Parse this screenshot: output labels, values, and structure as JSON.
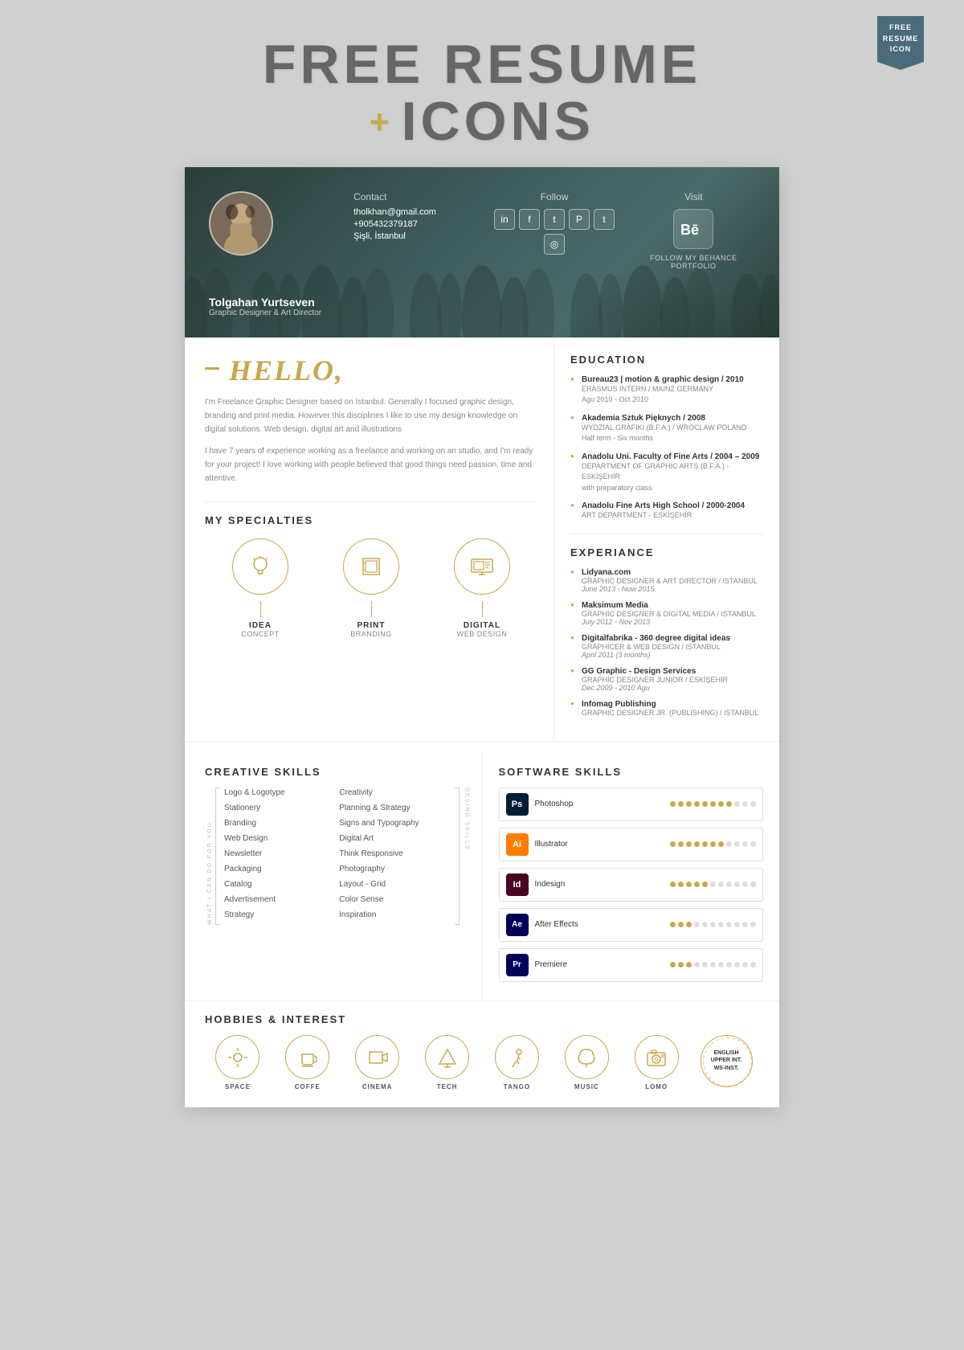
{
  "page": {
    "title_line1": "FREE RESUME",
    "title_plus": "+",
    "title_line2": "ICONS",
    "badge_line1": "FREE",
    "badge_line2": "RESUME",
    "badge_line3": "ICON"
  },
  "person": {
    "name": "Tolgahan Yurtseven",
    "title": "Graphic Designer & Art Director",
    "email": "tholkhan@gmail.com",
    "phone": "+905432379187",
    "location": "Şişli, İstanbul"
  },
  "contact": {
    "label": "Contact"
  },
  "follow": {
    "label": "Follow"
  },
  "visit": {
    "label": "Visit",
    "behance_text": "FOLLOW MY BEHANCE PORTFOLIO"
  },
  "hello": {
    "title": "HELLO,",
    "bio1": "I'm Freelance Graphic Designer based on Istanbul. Generally I focused graphic design, branding and print media. However this disciplines I like to use my design knowledge on digital solutions. Web design, digital art and illustrations",
    "bio2": "I have 7 years of experience working as a freelance and working on an studio, and I'm ready for your project! I love working with people believed that good things need passion, time and attentive."
  },
  "specialties": {
    "title": "MY SPECIALTIES",
    "items": [
      {
        "icon": "💡",
        "label": "IDEA",
        "sub": "CONCEPT"
      },
      {
        "icon": "🖨",
        "label": "PRINT",
        "sub": "BRANDING"
      },
      {
        "icon": "🖥",
        "label": "DIGITAL",
        "sub": "WEB DESIGN"
      }
    ]
  },
  "education": {
    "title": "EDUCATION",
    "items": [
      {
        "school": "Bureau23 | motion & graphic design / 2010",
        "detail": "ERASMUS INTERN / MAINZ GERMANY",
        "date": "Agu 2010 - Oct 2010"
      },
      {
        "school": "Akademia Sztuk Pięknych / 2008",
        "detail": "WYDZIAL GRAFIKI (B.F.A.) / WROCLAW POLAND",
        "date": "Half term - Six months"
      },
      {
        "school": "Anadolu Uni. Faculty of Fine Arts / 2004 – 2009",
        "detail": "DEPARTMENT OF GRAPHIC ARTS (B.F.A.) - ESKİŞEHİR",
        "date": "with preparatory class"
      },
      {
        "school": "Anadolu Fine Arts High School / 2000-2004",
        "detail": "ART DEPARTMENT - ESKİŞEHİR",
        "date": ""
      }
    ]
  },
  "experience": {
    "title": "EXPERIANCE",
    "items": [
      {
        "company": "Lidyana.com",
        "role": "GRAPHIC DESIGNER & ART DIRECTOR / ISTANBUL",
        "date": "June 2013 - Now 2015"
      },
      {
        "company": "Maksimum Media",
        "role": "GRAPHIC DESIGNER & DIGITAL MEDIA / ISTANBUL",
        "date": "July 2012 - Nov 2013"
      },
      {
        "company": "Digitalfabrika - 360 degree digital ideas",
        "role": "GRAPHICER & WEB DESIGN / ISTANBUL",
        "date": "April 2011 (3 months)"
      },
      {
        "company": "GG Graphic - Design Services",
        "role": "GRAPHIC DESIGNER JUNIOR / ESKİŞEHİR",
        "date": "Dec 2009 - 2010 Agu"
      },
      {
        "company": "Infomag Publishing",
        "role": "GRAPHIC DESIGNER JR. (PUBLISHING) / ISTANBUL",
        "date": ""
      }
    ]
  },
  "creative_skills": {
    "title": "CREATIVE SKILLS",
    "what_i_can": "WHAT I CAN DO FOR YOU",
    "design_skills": "DESING SKILLS",
    "col1": [
      "Logo & Logotype",
      "Stationery",
      "Branding",
      "Web Design",
      "Newsletter",
      "Packaging",
      "Catalog",
      "Advertisement",
      "Strategy"
    ],
    "col2": [
      "Creativity",
      "Planning & Strategy",
      "Signs and Typography",
      "Digital Art",
      "Think Responsive",
      "Photography",
      "Layout - Grid",
      "Color Sense",
      "Inspiration"
    ]
  },
  "software_skills": {
    "title": "SOFTWARE SKILLS",
    "items": [
      {
        "name": "Photoshop",
        "abbr": "Ps",
        "color": "ps",
        "filled": 8,
        "empty": 3
      },
      {
        "name": "Illustrator",
        "abbr": "Ai",
        "color": "ai",
        "filled": 7,
        "empty": 4
      },
      {
        "name": "Indesign",
        "abbr": "Id",
        "color": "id",
        "filled": 5,
        "empty": 6
      },
      {
        "name": "After Effects",
        "abbr": "Ae",
        "color": "ae",
        "filled": 3,
        "empty": 8
      },
      {
        "name": "Premiere",
        "abbr": "Pr",
        "color": "pr",
        "filled": 3,
        "empty": 8
      }
    ]
  },
  "hobbies": {
    "title": "HOBBIES & INTEREST",
    "items": [
      {
        "icon": "🔭",
        "label": "SPACE"
      },
      {
        "icon": "☕",
        "label": "COFFE"
      },
      {
        "icon": "🎬",
        "label": "CINEMA"
      },
      {
        "icon": "🚀",
        "label": "TECH"
      },
      {
        "icon": "💃",
        "label": "TANGO"
      },
      {
        "icon": "🎧",
        "label": "MUSIC"
      },
      {
        "icon": "📷",
        "label": "LOMO"
      }
    ],
    "language": {
      "label": "ENGLISH\nUPPER INT.\nWS-INST."
    }
  }
}
